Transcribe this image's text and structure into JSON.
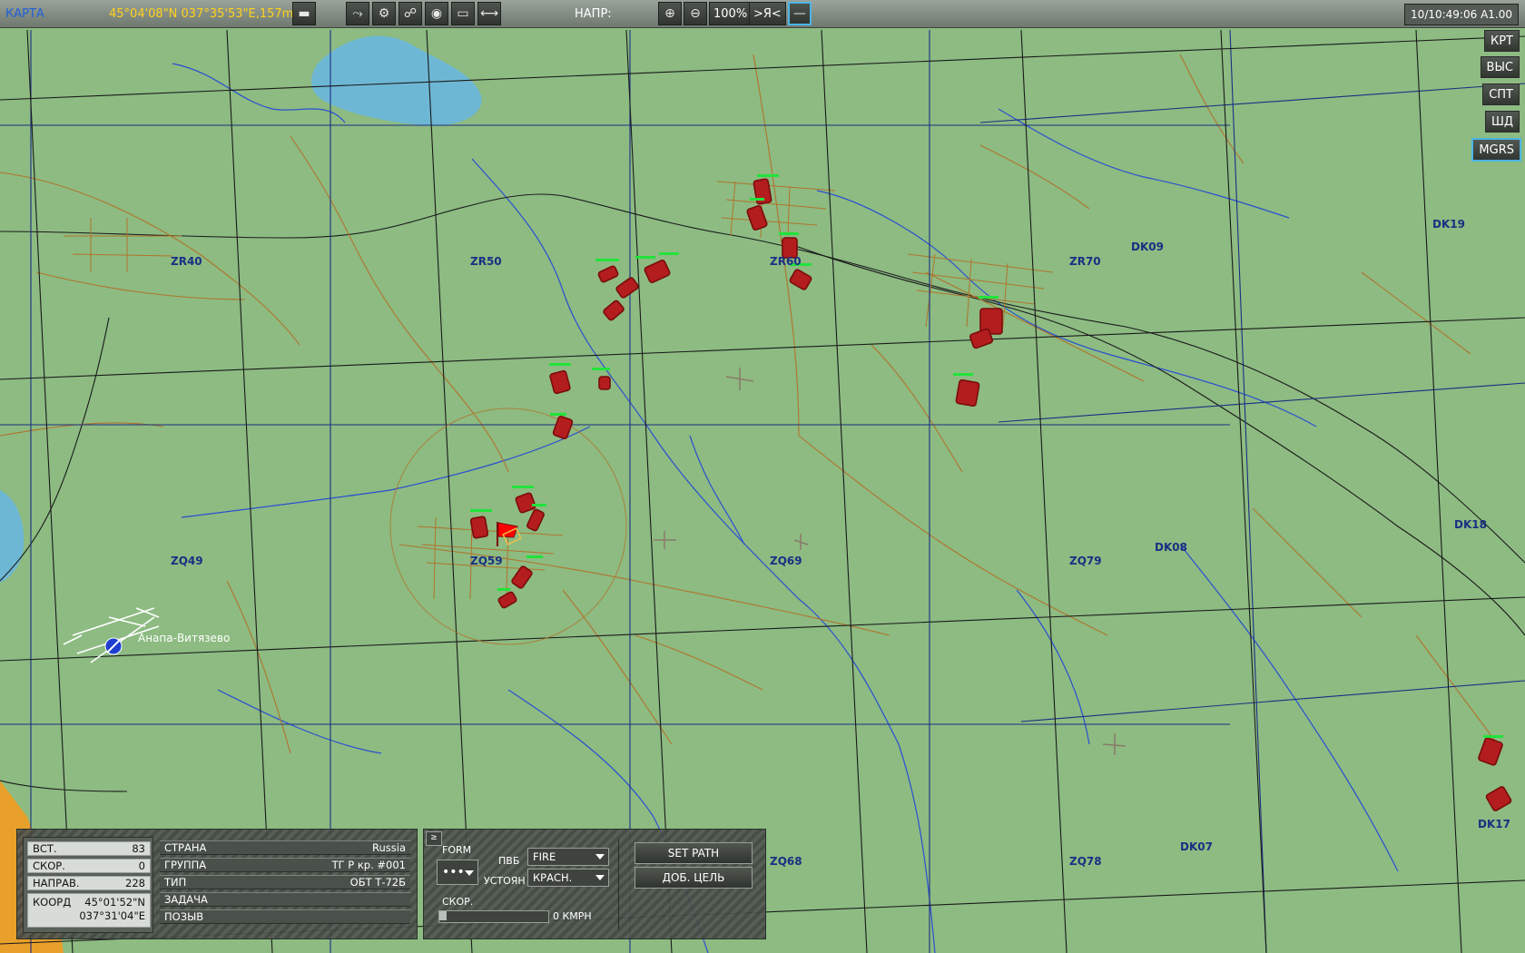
{
  "topbar": {
    "map_label": "КАРТА",
    "cursor_coords": "45°04'08\"N 037°35'53\"E,157m",
    "heading_label": "НАПР:",
    "zoom": "100%",
    "self_button": ">Я<",
    "clock": "10/10:49:06 A1.00",
    "tools": [
      "ruler-icon",
      "vehicle-icon",
      "link-icon",
      "gear-tool-icon",
      "pin-icon",
      "flag-icon",
      "chat-icon",
      "measure-icon"
    ]
  },
  "right_buttons": [
    {
      "label": "КРТ",
      "active": false
    },
    {
      "label": "ВЫС",
      "active": false
    },
    {
      "label": "СПТ",
      "active": false
    },
    {
      "label": "ШД",
      "active": false
    },
    {
      "label": "MGRS",
      "active": true
    }
  ],
  "grid_labels": [
    {
      "text": "ZR40"
    },
    {
      "text": "ZR50"
    },
    {
      "text": "ZR60"
    },
    {
      "text": "ZR70"
    },
    {
      "text": "DK09"
    },
    {
      "text": "DK19"
    },
    {
      "text": "DK18"
    },
    {
      "text": "DK08"
    },
    {
      "text": "ZQ49"
    },
    {
      "text": "ZQ59"
    },
    {
      "text": "ZQ69"
    },
    {
      "text": "ZQ79"
    },
    {
      "text": "ZQ68"
    },
    {
      "text": "ZQ78"
    },
    {
      "text": "DK07"
    },
    {
      "text": "DK17"
    }
  ],
  "airfield": {
    "name": "Анапа-Витязево"
  },
  "unit_panel": {
    "stats": [
      {
        "label": "ВСТ.",
        "value": "83"
      },
      {
        "label": "СКОР.",
        "value": "0"
      },
      {
        "label": "НАПРАВ.",
        "value": "228"
      }
    ],
    "coord_label": "КООРД",
    "coord_lat": "45°01'52\"N",
    "coord_lon": "037°31'04\"E",
    "info": [
      {
        "label": "СТРАНА",
        "value": "Russia"
      },
      {
        "label": "ГРУППА",
        "value": "ТГ Р кр. #001"
      },
      {
        "label": "ТИП",
        "value": "ОБТ Т-72Б"
      },
      {
        "label": "ЗАДАЧА",
        "value": ""
      },
      {
        "label": "ПОЗЫВ",
        "value": ""
      }
    ]
  },
  "orders_panel": {
    "form_label": "FORM",
    "form_value": "•••",
    "roe_label": "ПВБ",
    "roe_value": "FIRE",
    "alarm_label": "УСТОЯН",
    "alarm_value": "КРАСН.",
    "speed_label": "СКОР.",
    "speed_value": "0 КМРН",
    "speed_fraction": 0.0,
    "set_path": "SET PATH",
    "add_target": "ДОБ. ЦЕЛЬ"
  },
  "colors": {
    "land": "#8dbb82",
    "grid": "#1b2f83",
    "water": "#6eb7d4",
    "road": "#b0742b",
    "unit": "#b31d1d"
  }
}
